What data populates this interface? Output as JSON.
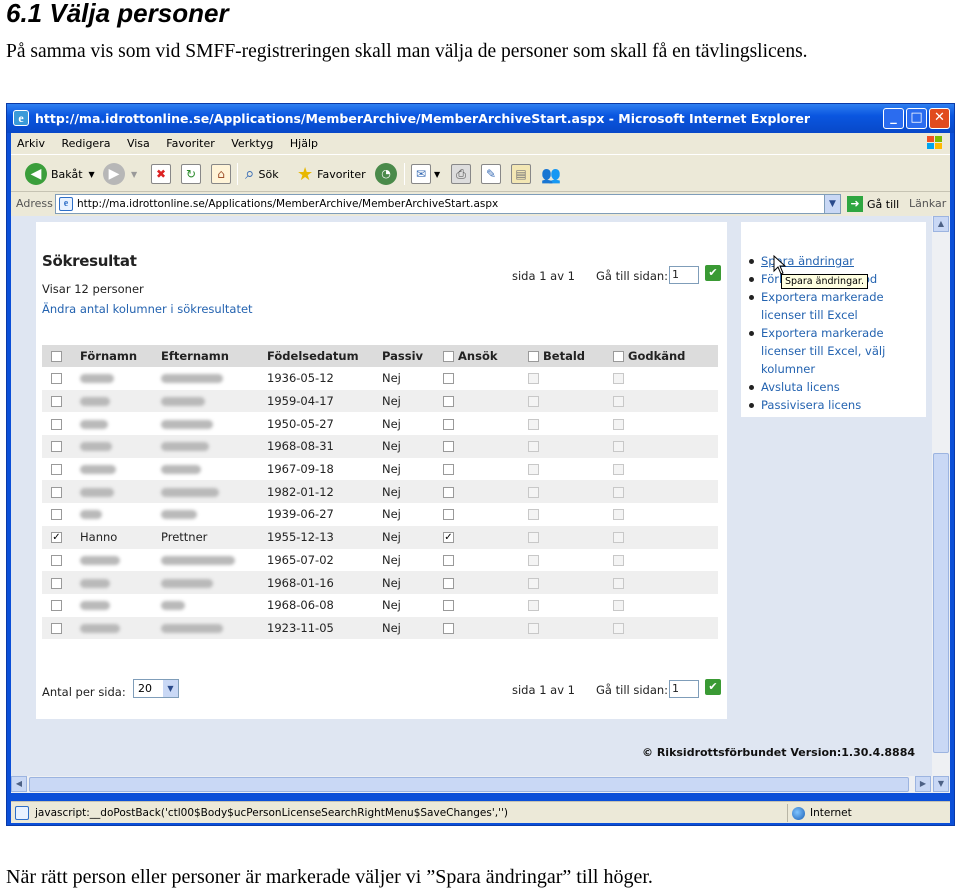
{
  "document": {
    "heading": "6.1  Välja personer",
    "intro": "På samma vis som vid SMFF-registreringen skall man välja de personer som skall få en tävlingslicens.",
    "footer": "När rätt person eller personer är markerade väljer vi ”Spara ändringar” till höger."
  },
  "browser": {
    "title": "http://ma.idrottonline.se/Applications/MemberArchive/MemberArchiveStart.aspx - Microsoft Internet Explorer",
    "menu": [
      "Arkiv",
      "Redigera",
      "Visa",
      "Favoriter",
      "Verktyg",
      "Hjälp"
    ],
    "toolbar": {
      "back": "Bakåt",
      "search": "Sök",
      "favorites": "Favoriter"
    },
    "address_label": "Adress",
    "address_url": "http://ma.idrottonline.se/Applications/MemberArchive/MemberArchiveStart.aspx",
    "go_label": "Gå till",
    "links_label": "Länkar",
    "status_text": "javascript:__doPostBack('ctl00$Body$ucPersonLicenseSearchRightMenu$SaveChanges','')",
    "zone": "Internet"
  },
  "page": {
    "title": "Sökresultat",
    "showing": "Visar 12 personer",
    "change_columns": "Ändra antal kolumner i sökresultatet",
    "pager_text": "sida 1 av 1",
    "goto_label": "Gå till sidan:",
    "goto_value": "1",
    "per_page_label": "Antal per sida:",
    "per_page_value": "20",
    "columns": [
      "Förnamn",
      "Efternamn",
      "Födelsedatum",
      "Passiv",
      "Ansök",
      "Betald",
      "Godkänd"
    ],
    "rows": [
      {
        "first": "",
        "last": "",
        "birth": "1936-05-12",
        "passive": "Nej",
        "checked": false,
        "apply": false
      },
      {
        "first": "",
        "last": "",
        "birth": "1959-04-17",
        "passive": "Nej",
        "checked": false,
        "apply": false
      },
      {
        "first": "",
        "last": "",
        "birth": "1950-05-27",
        "passive": "Nej",
        "checked": false,
        "apply": false
      },
      {
        "first": "",
        "last": "",
        "birth": "1968-08-31",
        "passive": "Nej",
        "checked": false,
        "apply": false
      },
      {
        "first": "",
        "last": "",
        "birth": "1967-09-18",
        "passive": "Nej",
        "checked": false,
        "apply": false
      },
      {
        "first": "",
        "last": "",
        "birth": "1982-01-12",
        "passive": "Nej",
        "checked": false,
        "apply": false
      },
      {
        "first": "",
        "last": "",
        "birth": "1939-06-27",
        "passive": "Nej",
        "checked": false,
        "apply": false
      },
      {
        "first": "Hanno",
        "last": "Prettner",
        "birth": "1955-12-13",
        "passive": "Nej",
        "checked": true,
        "apply": true
      },
      {
        "first": "",
        "last": "",
        "birth": "1965-07-02",
        "passive": "Nej",
        "checked": false,
        "apply": false
      },
      {
        "first": "",
        "last": "",
        "birth": "1968-01-16",
        "passive": "Nej",
        "checked": false,
        "apply": false
      },
      {
        "first": "",
        "last": "",
        "birth": "1968-06-08",
        "passive": "Nej",
        "checked": false,
        "apply": false
      },
      {
        "first": "",
        "last": "",
        "birth": "1923-11-05",
        "passive": "Nej",
        "checked": false,
        "apply": false
      }
    ],
    "right_menu": [
      "Spara ändringar",
      "Förläng licensperiod",
      "Exportera markerade licenser till Excel",
      "Exportera markerade licenser till Excel, välj kolumner",
      "Avsluta licens",
      "Passivisera licens"
    ],
    "tooltip": "Spara ändringar.",
    "copyright": "© Riksidrottsförbundet  Version:1.30.4.8884"
  },
  "colors": {
    "link": "#2463b0",
    "title_bar": "#0a56e0",
    "chrome": "#ece9d8"
  }
}
